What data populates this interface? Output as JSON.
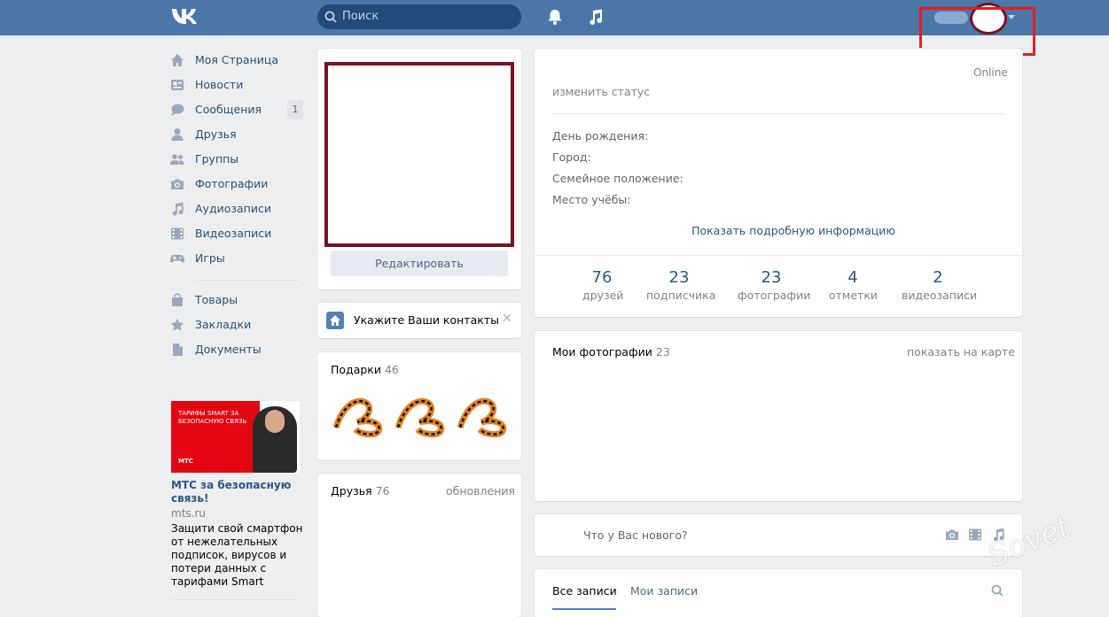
{
  "header": {
    "logo": "VK",
    "search_placeholder": "Поиск"
  },
  "menu": {
    "items": [
      {
        "label": "Моя Страница"
      },
      {
        "label": "Новости"
      },
      {
        "label": "Сообщения",
        "count": "1"
      },
      {
        "label": "Друзья"
      },
      {
        "label": "Группы"
      },
      {
        "label": "Фотографии"
      },
      {
        "label": "Аудиозаписи"
      },
      {
        "label": "Видеозаписи"
      },
      {
        "label": "Игры"
      },
      {
        "label": "Товары"
      },
      {
        "label": "Закладки"
      },
      {
        "label": "Документы"
      }
    ]
  },
  "ad": {
    "image_text_1": "ТАРИФЫ SMART ЗА",
    "image_text_2": "БЕЗОПАСНУЮ СВЯЗЬ",
    "image_brand": "МТС",
    "title": "МТС за безопасную связь!",
    "url": "mts.ru",
    "description": "Защити свой смартфон от нежелательных подписок, вирусов и потери данных с тарифами Smart"
  },
  "profile": {
    "edit_button": "Редактировать",
    "contacts_prompt": "Укажите Ваши контакты",
    "contacts_close": "✕",
    "gifts": {
      "title": "Подарки",
      "count": "46"
    },
    "friends": {
      "title": "Друзья",
      "count": "76",
      "updates": "обновления"
    }
  },
  "info": {
    "online": "Online",
    "status": "изменить статус",
    "fields": [
      {
        "label": "День рождения:"
      },
      {
        "label": "Город:"
      },
      {
        "label": "Семейное положение:"
      },
      {
        "label": "Место учёбы:"
      }
    ],
    "show_more": "Показать подробную информацию",
    "stats": [
      {
        "value": "76",
        "label": "друзей"
      },
      {
        "value": "23",
        "label": "подписчика"
      },
      {
        "value": "23",
        "label": "фотографии"
      },
      {
        "value": "4",
        "label": "отметки"
      },
      {
        "value": "2",
        "label": "видеозаписи"
      }
    ]
  },
  "photos": {
    "title": "Мои фотографии",
    "count": "23",
    "map_link": "показать на карте"
  },
  "post": {
    "placeholder": "Что у Вас нового?"
  },
  "wall": {
    "tab_all": "Все записи",
    "tab_mine": "Мои записи"
  },
  "watermark": "Sovet",
  "colors": {
    "header": "#4a76a8",
    "link": "#2a5885",
    "highlight": "#e02020",
    "avatar_border": "#7b0f24"
  }
}
